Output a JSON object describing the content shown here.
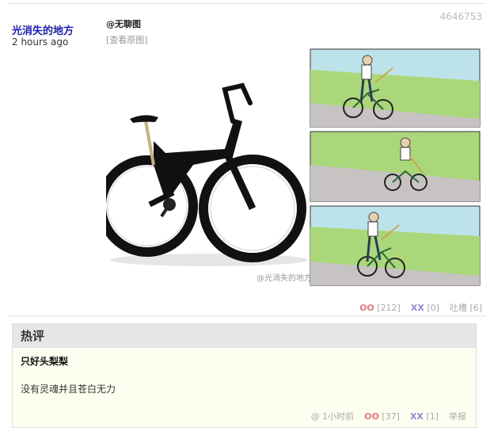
{
  "post": {
    "author": "光消失的地方",
    "time": "2 hours ago",
    "id": "4646753",
    "source": "@无聊图",
    "view_original": "[查看原图]",
    "watermark": "@光消失的地方",
    "oo_label": "OO",
    "oo_count": "[212]",
    "xx_label": "XX",
    "xx_count": "[0]",
    "tucao": "吐槽 [6]"
  },
  "hot_comments": {
    "title": "热评",
    "author": "只好头梨梨",
    "body": "没有灵魂并且苍白无力",
    "at": "@",
    "time": "1小时前",
    "oo_label": "OO",
    "oo_count": "[37]",
    "xx_label": "XX",
    "xx_count": "[1]",
    "report": "举报"
  },
  "colors": {
    "author_link": "#1a1acc",
    "oo": "#e87777",
    "xx": "#8a8ae6",
    "hot_bg": "#fefef0"
  }
}
